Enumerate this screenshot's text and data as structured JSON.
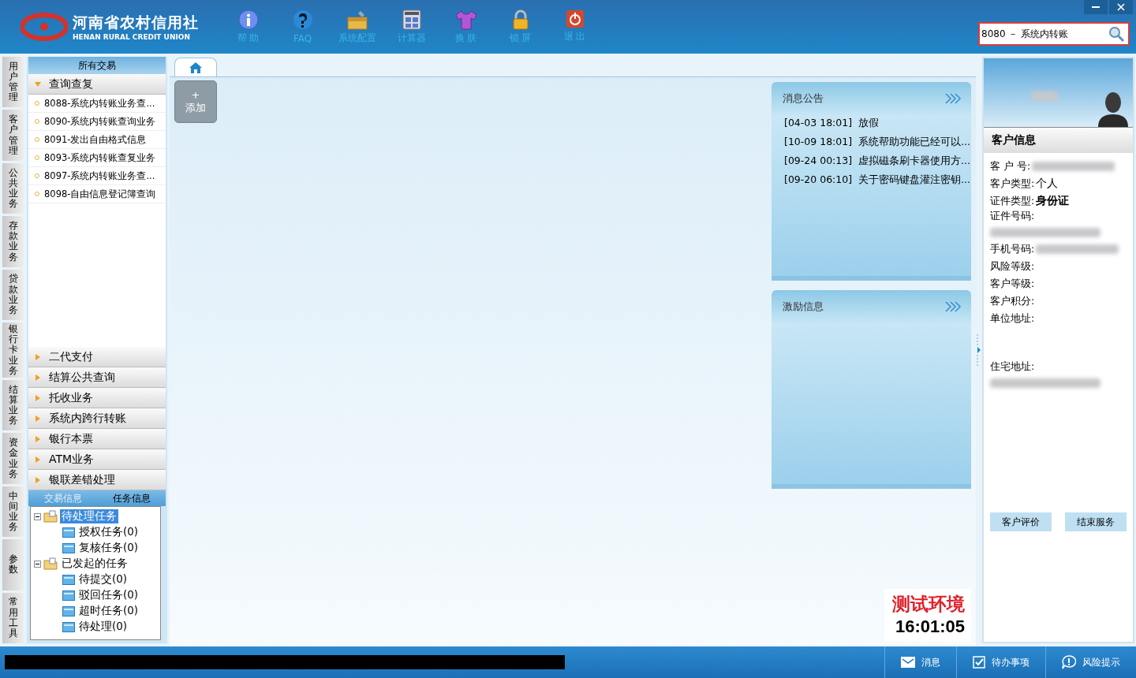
{
  "header": {
    "logo_title": "河南省农村信用社",
    "logo_subtitle": "HENAN RURAL CREDIT UNION",
    "toolbar": [
      {
        "label": "帮 助",
        "kind": "info"
      },
      {
        "label": "FAQ",
        "kind": "faq"
      },
      {
        "label": "系统配置",
        "kind": "config"
      },
      {
        "label": "计算器",
        "kind": "calculator"
      },
      {
        "label": "换 肤",
        "kind": "skin"
      },
      {
        "label": "锁 屏",
        "kind": "lock"
      },
      {
        "label": "退 出",
        "kind": "exit"
      }
    ],
    "search": {
      "value": "8080 － 系统内转账"
    }
  },
  "side_tabs": [
    "用户管理",
    "客户管理",
    "公共业务",
    "存款业务",
    "贷款业务",
    "银行卡业务",
    "结算业务",
    "资金业务",
    "中间业务",
    "参数",
    "常用工具"
  ],
  "nav": {
    "title": "所有交易",
    "groups": [
      {
        "label": "查询查复",
        "expanded": true,
        "items": [
          "8088-系统内转账业务查...",
          "8090-系统内转账查询业务",
          "8091-发出自由格式信息",
          "8093-系统内转账查复业务",
          "8097-系统内转账业务查...",
          "8098-自由信息登记簿查询"
        ]
      },
      {
        "label": "二代支付",
        "expanded": false
      },
      {
        "label": "结算公共查询",
        "expanded": false
      },
      {
        "label": "托收业务",
        "expanded": false
      },
      {
        "label": "系统内跨行转账",
        "expanded": false
      },
      {
        "label": "银行本票",
        "expanded": false
      },
      {
        "label": "ATM业务",
        "expanded": false
      },
      {
        "label": "银联差错处理",
        "expanded": false
      }
    ],
    "bottom_tabs": [
      {
        "label": "交易信息",
        "selected": false
      },
      {
        "label": "任务信息",
        "selected": true
      }
    ],
    "tree": [
      {
        "label": "待处理任务",
        "selected": true,
        "children": [
          {
            "label": "授权任务(0)",
            "selected": false
          },
          {
            "label": "复核任务(0)",
            "selected": false
          }
        ]
      },
      {
        "label": "已发起的任务",
        "selected": false,
        "children": [
          {
            "label": "待提交(0)",
            "selected": false
          },
          {
            "label": "驳回任务(0)",
            "selected": false
          },
          {
            "label": "超时任务(0)",
            "selected": false
          },
          {
            "label": "待处理(0)",
            "selected": false
          }
        ]
      }
    ]
  },
  "main": {
    "add_label": "添加",
    "add_plus": "+",
    "panels": [
      {
        "title": "消息公告",
        "notices": [
          {
            "time": "[04-03 18:01]",
            "text": "放假"
          },
          {
            "time": "[10-09 18:01]",
            "text": "系统帮助功能已经可以...."
          },
          {
            "time": "[09-24 00:13]",
            "text": "虚拟磁条刷卡器使用方...."
          },
          {
            "time": "[09-20 06:10]",
            "text": "关于密码键盘灌注密钥...."
          }
        ]
      },
      {
        "title": "激励信息"
      }
    ],
    "environment": "测试环境",
    "time": "16:01:05"
  },
  "customer": {
    "title": "客户信息",
    "fields": [
      {
        "label": "客 户 号:",
        "kind": "blurred"
      },
      {
        "label": "客户类型:",
        "kind": "value",
        "value": "个人",
        "bold": false
      },
      {
        "label": "证件类型:",
        "kind": "value",
        "value": "身份证",
        "bold": true
      },
      {
        "label": "证件号码:",
        "kind": "blurred_below"
      },
      {
        "label": "手机号码:",
        "kind": "blurred"
      },
      {
        "label": "风险等级:",
        "kind": "empty"
      },
      {
        "label": "客户等级:",
        "kind": "empty"
      },
      {
        "label": "客户积分:",
        "kind": "empty"
      },
      {
        "label": "单位地址:",
        "kind": "tall"
      },
      {
        "label": "住宅地址:",
        "kind": "blurred_below"
      }
    ],
    "buttons": [
      "客户评价",
      "结束服务"
    ]
  },
  "status_bar": [
    {
      "label": "消息",
      "kind": "mail"
    },
    {
      "label": "待办事项",
      "kind": "check"
    },
    {
      "label": "风险提示",
      "kind": "alert"
    }
  ]
}
